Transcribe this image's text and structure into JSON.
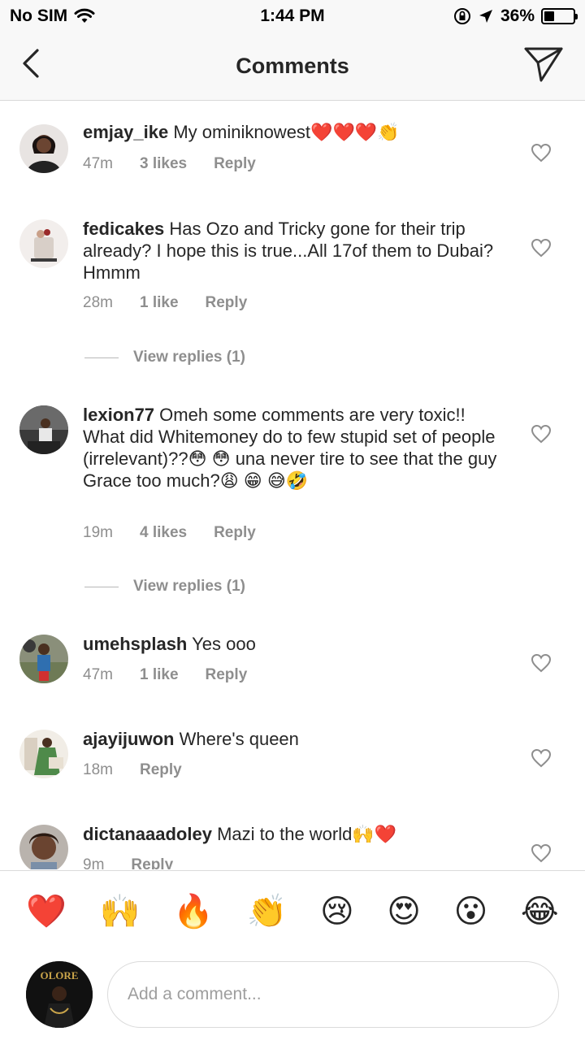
{
  "status": {
    "carrier": "No SIM",
    "time": "1:44 PM",
    "battery": "36%",
    "battery_level": 0.36
  },
  "nav": {
    "title": "Comments",
    "back_icon": "chevron-left-icon",
    "send_icon": "paper-plane-icon"
  },
  "comments": [
    {
      "username": "emjay_ike",
      "text": "My ominiknowest❤️❤️❤️👏",
      "time": "47m",
      "likes": "3 likes",
      "reply": "Reply"
    },
    {
      "username": "fedicakes",
      "text": "Has Ozo and Tricky gone for their trip already? I hope this is true...All 17of them to Dubai? Hmmm",
      "time": "28m",
      "likes": "1 like",
      "reply": "Reply",
      "view_replies": "View replies (1)"
    },
    {
      "username": "lexion77",
      "text": "Omeh  some comments are very toxic!! What did Whitemoney do to few stupid set of people (irrelevant)??😳 😳 una never tire to see that the guy Grace too much?😩 😁 😅🤣",
      "time": "19m",
      "likes": "4 likes",
      "reply": "Reply",
      "view_replies": "View replies (1)"
    },
    {
      "username": "umehsplash",
      "text": "Yes ooo",
      "time": "47m",
      "likes": "1 like",
      "reply": "Reply"
    },
    {
      "username": "ajayijuwon",
      "text": "Where's queen",
      "time": "18m",
      "likes": "",
      "reply": "Reply"
    },
    {
      "username": "dictanaaadoley",
      "text": "Mazi to the world🙌❤️",
      "time": "9m",
      "likes": "",
      "reply": "Reply"
    }
  ],
  "reactions": [
    "❤️",
    "🙌",
    "🔥",
    "👏",
    "😢",
    "😍",
    "😮",
    "😂"
  ],
  "composer": {
    "placeholder": "Add a comment...",
    "avatar_text": "OLORE"
  },
  "colors": {
    "text": "#262626",
    "meta": "#8e8e8e",
    "divider": "#dbdbdb"
  }
}
